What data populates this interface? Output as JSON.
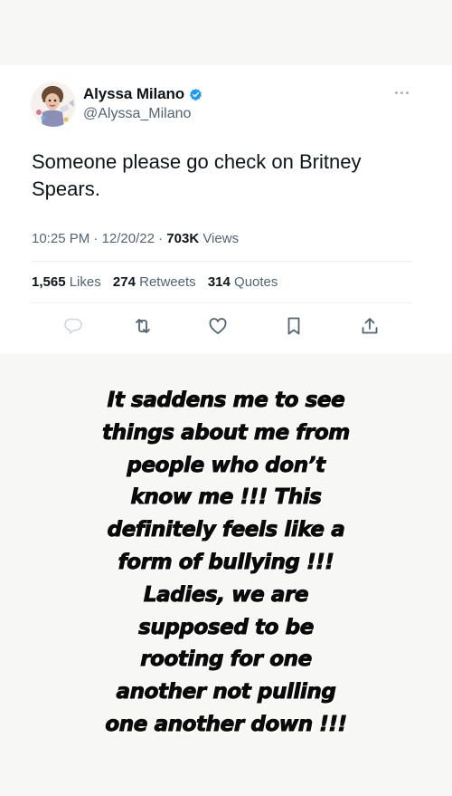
{
  "tweet": {
    "author_name": "Alyssa Milano",
    "handle": "@Alyssa_Milano",
    "text_lines": [
      "Someone please go check on Britney",
      "Spears."
    ],
    "time": "10:25 PM",
    "date": "12/20/22",
    "separator": "·",
    "views_count": "703K",
    "views_label": "Views",
    "likes_count": "1,565",
    "likes_label": "Likes",
    "retweets_count": "274",
    "retweets_label": "Retweets",
    "quotes_count": "314",
    "quotes_label": "Quotes",
    "verified_color": "#1d9bf0",
    "icons": [
      "reply-icon",
      "retweet-icon",
      "like-icon",
      "bookmark-icon",
      "share-icon",
      "more-icon",
      "verified-icon"
    ]
  },
  "statement": {
    "lines": [
      "It saddens me to see",
      "things about me from",
      "people who don’t",
      "know me !!! This",
      "definitely feels like a",
      "form of bullying !!!",
      "Ladies, we are",
      "supposed to be",
      "rooting for one",
      "another not pulling",
      "one another down !!!"
    ]
  },
  "colors": {
    "text_primary": "#0f1419",
    "text_secondary": "#536471",
    "background": "#f7f7f5"
  }
}
